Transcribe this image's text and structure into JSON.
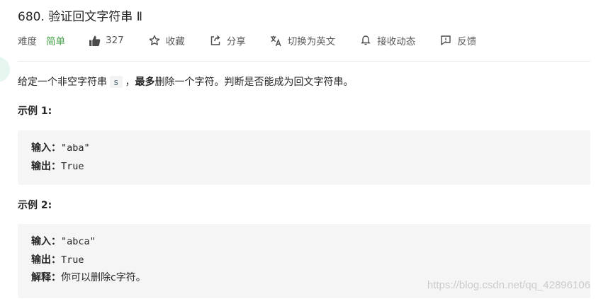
{
  "title": "680. 验证回文字符串 Ⅱ",
  "meta": {
    "difficulty_label": "难度",
    "difficulty_value": "简单",
    "likes": "327",
    "collect": "收藏",
    "share": "分享",
    "translate": "切换为英文",
    "subscribe": "接收动态",
    "feedback": "反馈"
  },
  "description": {
    "part1": "给定一个非空字符串",
    "code": "s",
    "part2": "，",
    "bold": "最多",
    "part3": "删除一个字符。判断是否能成为回文字符串。"
  },
  "examples": [
    {
      "title": "示例 1:",
      "input_label": "输入：",
      "input_value": "\"aba\"",
      "output_label": "输出：",
      "output_value": "True"
    },
    {
      "title": "示例 2:",
      "input_label": "输入：",
      "input_value": "\"abca\"",
      "output_label": "输出：",
      "output_value": "True",
      "explain_label": "解释：",
      "explain_value": "你可以删除c字符。"
    }
  ],
  "watermark": "https://blog.csdn.net/qq_42896106",
  "colors": {
    "easy": "#43a047",
    "code_bg": "#f3f3f3",
    "example_bg": "#f5f5f5"
  }
}
